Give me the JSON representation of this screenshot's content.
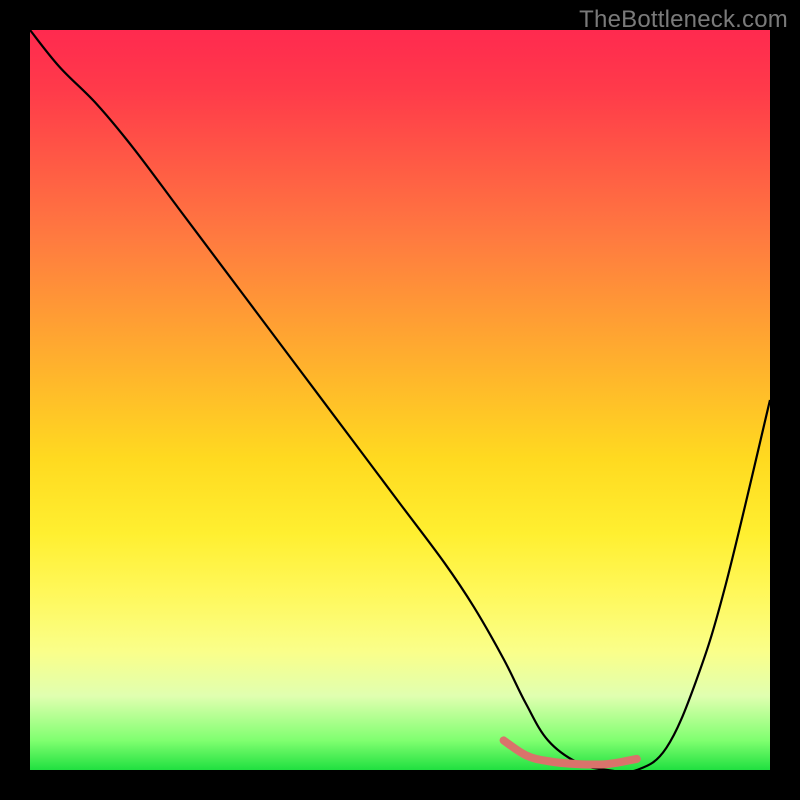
{
  "watermark": "TheBottleneck.com",
  "chart_data": {
    "type": "line",
    "title": "",
    "xlabel": "",
    "ylabel": "",
    "xlim": [
      0,
      100
    ],
    "ylim": [
      0,
      100
    ],
    "grid": false,
    "series": [
      {
        "name": "curve",
        "x": [
          0,
          4,
          9,
          14,
          20,
          26,
          32,
          38,
          44,
          50,
          56,
          60,
          64,
          67,
          70,
          74,
          78,
          82,
          86,
          90,
          94,
          100
        ],
        "y": [
          100,
          95,
          90,
          84,
          76,
          68,
          60,
          52,
          44,
          36,
          28,
          22,
          15,
          9,
          4,
          1,
          0,
          0,
          3,
          12,
          25,
          50
        ],
        "color": "#000000"
      },
      {
        "name": "optimal-range",
        "x": [
          64,
          67,
          70,
          74,
          78,
          82
        ],
        "y": [
          4,
          2,
          1.2,
          0.8,
          0.8,
          1.5
        ],
        "color": "#d9736b"
      }
    ],
    "background_gradient": {
      "top": "#ff2a4f",
      "mid": "#ffef30",
      "bottom": "#20e040"
    }
  }
}
